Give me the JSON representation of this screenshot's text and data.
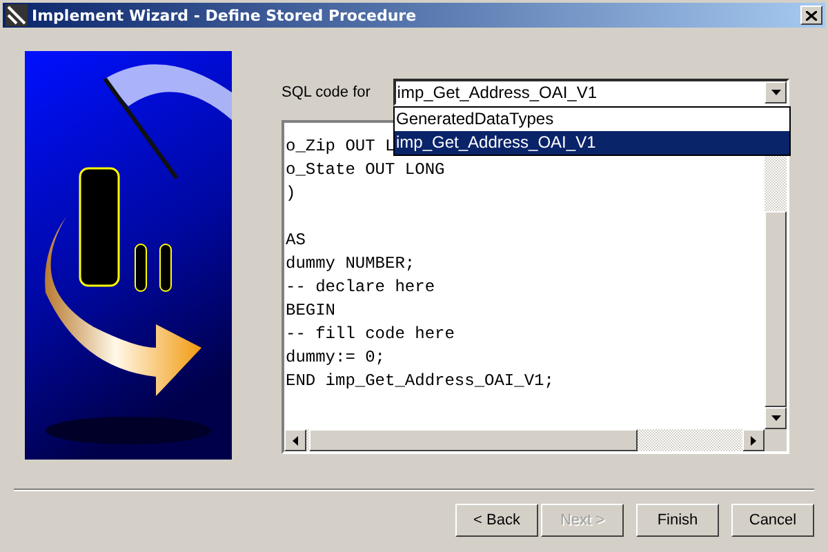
{
  "window": {
    "title": "Implement Wizard - Define Stored Procedure"
  },
  "sql_code_for": {
    "label": "SQL code for",
    "value": "imp_Get_Address_OAI_V1",
    "expanded": true,
    "options": [
      {
        "label": "GeneratedDataTypes",
        "selected": false
      },
      {
        "label": "imp_Get_Address_OAI_V1",
        "selected": true
      }
    ]
  },
  "code": "o_Zip OUT L\no_State OUT LONG\n)\n\nAS\ndummy NUMBER;\n-- declare here\nBEGIN\n-- fill code here\ndummy:= 0;\nEND imp_Get_Address_OAI_V1;",
  "buttons": [
    {
      "label": "< Back",
      "disabled": false
    },
    {
      "label": "Next >",
      "disabled": true
    },
    {
      "label": "Finish",
      "disabled": false
    },
    {
      "label": "Cancel",
      "disabled": false
    }
  ]
}
